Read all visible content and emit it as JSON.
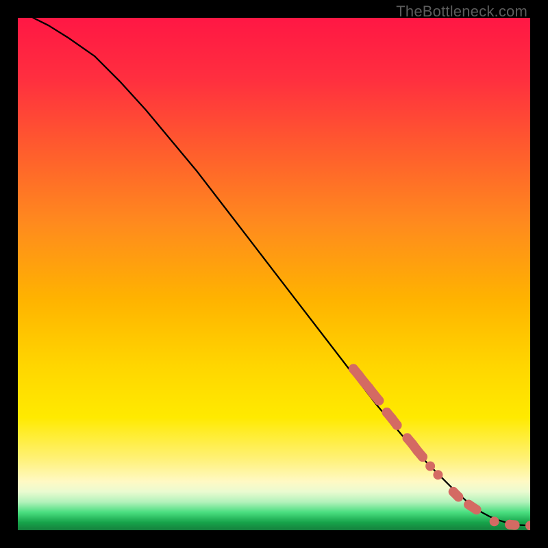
{
  "watermark": "TheBottleneck.com",
  "colors": {
    "marker": "#d46a63",
    "line": "#000000",
    "gradient_stops": [
      {
        "offset": 0.0,
        "color": "#ff1744"
      },
      {
        "offset": 0.12,
        "color": "#ff2f3f"
      },
      {
        "offset": 0.25,
        "color": "#ff5a2e"
      },
      {
        "offset": 0.4,
        "color": "#ff8a1e"
      },
      {
        "offset": 0.55,
        "color": "#ffb300"
      },
      {
        "offset": 0.68,
        "color": "#ffd600"
      },
      {
        "offset": 0.78,
        "color": "#ffea00"
      },
      {
        "offset": 0.86,
        "color": "#fff176"
      },
      {
        "offset": 0.905,
        "color": "#fff9c4"
      },
      {
        "offset": 0.925,
        "color": "#eafbd0"
      },
      {
        "offset": 0.945,
        "color": "#b2f2bb"
      },
      {
        "offset": 0.965,
        "color": "#4ade80"
      },
      {
        "offset": 0.985,
        "color": "#16a34a"
      },
      {
        "offset": 1.0,
        "color": "#15803d"
      }
    ]
  },
  "chart_data": {
    "type": "line",
    "title": "",
    "xlabel": "",
    "ylabel": "",
    "xlim": [
      0,
      100
    ],
    "ylim": [
      0,
      100
    ],
    "series": [
      {
        "name": "curve",
        "x": [
          3,
          6,
          10,
          15,
          20,
          25,
          30,
          35,
          40,
          45,
          50,
          55,
          60,
          65,
          70,
          75,
          80,
          85,
          88,
          90,
          92,
          94,
          96,
          98,
          100
        ],
        "y": [
          100,
          98.5,
          96,
          92.5,
          87.5,
          82,
          76,
          70,
          63.5,
          57,
          50.5,
          44,
          37.5,
          31,
          24.5,
          18.5,
          13,
          8,
          5.3,
          3.8,
          2.7,
          1.9,
          1.3,
          1.0,
          0.9
        ]
      }
    ],
    "markers": {
      "name": "segments",
      "points": [
        {
          "x": 65.5,
          "y": 31.5
        },
        {
          "x": 66.5,
          "y": 30.3
        },
        {
          "x": 67.5,
          "y": 29.0
        },
        {
          "x": 68.5,
          "y": 27.8
        },
        {
          "x": 69.5,
          "y": 26.5
        },
        {
          "x": 70.5,
          "y": 25.3
        },
        {
          "x": 72.0,
          "y": 23.0
        },
        {
          "x": 73.0,
          "y": 21.8
        },
        {
          "x": 74.0,
          "y": 20.5
        },
        {
          "x": 76.0,
          "y": 18.0
        },
        {
          "x": 77.0,
          "y": 16.8
        },
        {
          "x": 78.0,
          "y": 15.5
        },
        {
          "x": 79.0,
          "y": 14.3
        },
        {
          "x": 80.5,
          "y": 12.5
        },
        {
          "x": 82.0,
          "y": 10.8
        },
        {
          "x": 85.0,
          "y": 7.5
        },
        {
          "x": 86.0,
          "y": 6.5
        },
        {
          "x": 88.0,
          "y": 5.0
        },
        {
          "x": 89.5,
          "y": 4.0
        },
        {
          "x": 93.0,
          "y": 1.7
        },
        {
          "x": 96.0,
          "y": 1.1
        },
        {
          "x": 97.0,
          "y": 1.0
        },
        {
          "x": 100.0,
          "y": 0.9
        }
      ]
    }
  }
}
